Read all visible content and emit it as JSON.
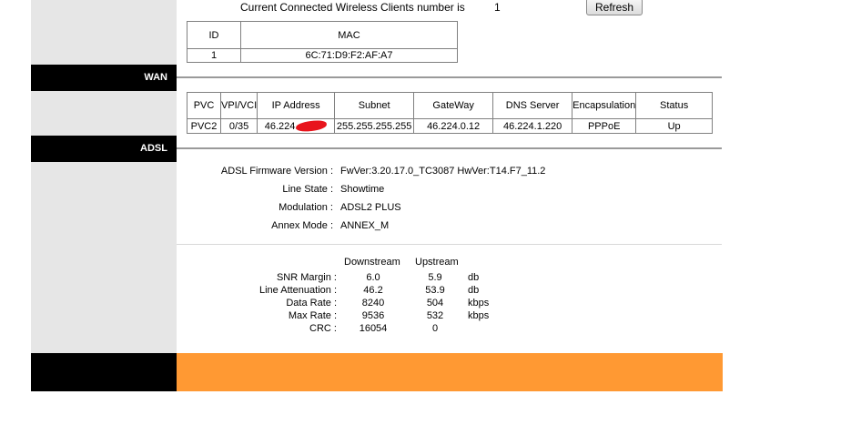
{
  "wireless": {
    "clients_label": "Current Connected Wireless Clients number is",
    "clients_count": "1",
    "refresh_label": "Refresh",
    "table": {
      "headers": [
        "ID",
        "MAC"
      ],
      "rows": [
        [
          "1",
          "6C:71:D9:F2:AF:A7"
        ]
      ]
    }
  },
  "wan": {
    "section_title": "WAN",
    "table": {
      "headers": [
        "PVC",
        "VPI/VCI",
        "IP Address",
        "Subnet",
        "GateWay",
        "DNS Server",
        "Encapsulation",
        "Status"
      ],
      "row": {
        "pvc": "PVC2",
        "vpi_vci": "0/35",
        "ip_address": "46.224.",
        "subnet": "255.255.255.255",
        "gateway": "46.224.0.12",
        "dns": "46.224.1.220",
        "encapsulation": "PPPoE",
        "status": "Up"
      }
    }
  },
  "adsl": {
    "section_title": "ADSL",
    "info": [
      {
        "label": "ADSL Firmware Version :",
        "value": "FwVer:3.20.17.0_TC3087 HwVer:T14.F7_11.2"
      },
      {
        "label": "Line State :",
        "value": "Showtime"
      },
      {
        "label": "Modulation :",
        "value": "ADSL2 PLUS"
      },
      {
        "label": "Annex Mode :",
        "value": "ANNEX_M"
      }
    ],
    "stats": {
      "downstream_header": "Downstream",
      "upstream_header": "Upstream",
      "rows": [
        {
          "label": "SNR Margin :",
          "down": "6.0",
          "up": "5.9",
          "unit": "db"
        },
        {
          "label": "Line Attenuation :",
          "down": "46.2",
          "up": "53.9",
          "unit": "db"
        },
        {
          "label": "Data Rate :",
          "down": "8240",
          "up": "504",
          "unit": "kbps"
        },
        {
          "label": "Max Rate :",
          "down": "9536",
          "up": "532",
          "unit": "kbps"
        },
        {
          "label": "CRC :",
          "down": "16054",
          "up": "0",
          "unit": ""
        }
      ]
    }
  },
  "colors": {
    "sidebar": "#e6e6e6",
    "section_bar": "#000000",
    "footer_accent": "#ff9933",
    "redaction": "#e8141c"
  }
}
